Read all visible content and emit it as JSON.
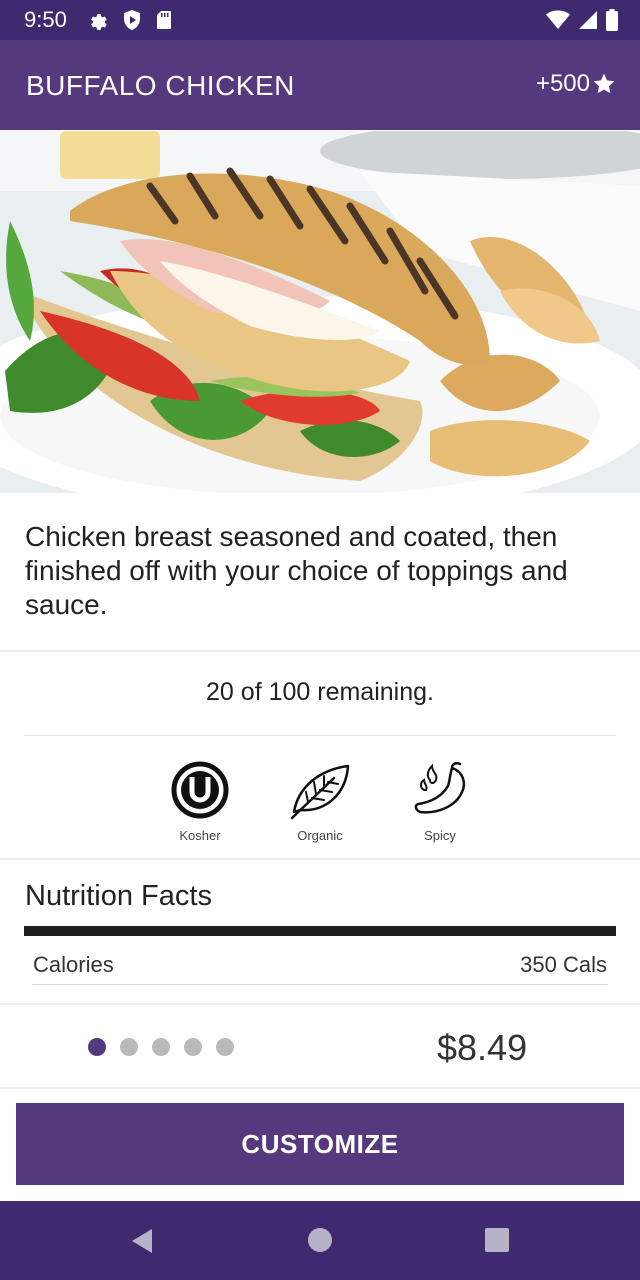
{
  "status_bar": {
    "time": "9:50",
    "icons_left": [
      "gear-icon",
      "shield-play-icon",
      "sd-card-icon"
    ],
    "icons_right": [
      "wifi-icon",
      "signal-icon",
      "battery-icon"
    ]
  },
  "app_bar": {
    "title": "BUFFALO CHICKEN",
    "points": "+500",
    "points_icon": "star-icon"
  },
  "hero": {
    "icon": "food-photo-sandwich"
  },
  "description": "Chicken breast seasoned and coated, then finished off with your choice of toppings and sauce.",
  "availability": "20 of 100 remaining.",
  "attributes": [
    {
      "label": "Kosher",
      "icon": "kosher-icon"
    },
    {
      "label": "Organic",
      "icon": "leaf-icon"
    },
    {
      "label": "Spicy",
      "icon": "chili-pepper-icon"
    }
  ],
  "nutrition": {
    "title": "Nutrition Facts",
    "rows": [
      {
        "label": "Calories",
        "value": "350 Cals"
      }
    ]
  },
  "pager": {
    "pages": 5,
    "active_index": 0
  },
  "price": "$8.49",
  "customize_label": "CUSTOMIZE",
  "nav": [
    "back-icon",
    "home-icon",
    "recents-icon"
  ],
  "colors": {
    "primary": "#55397f",
    "status_bar": "#3f2a70",
    "active_dot": "#55397f",
    "inactive_dot": "#b9b9b9"
  }
}
